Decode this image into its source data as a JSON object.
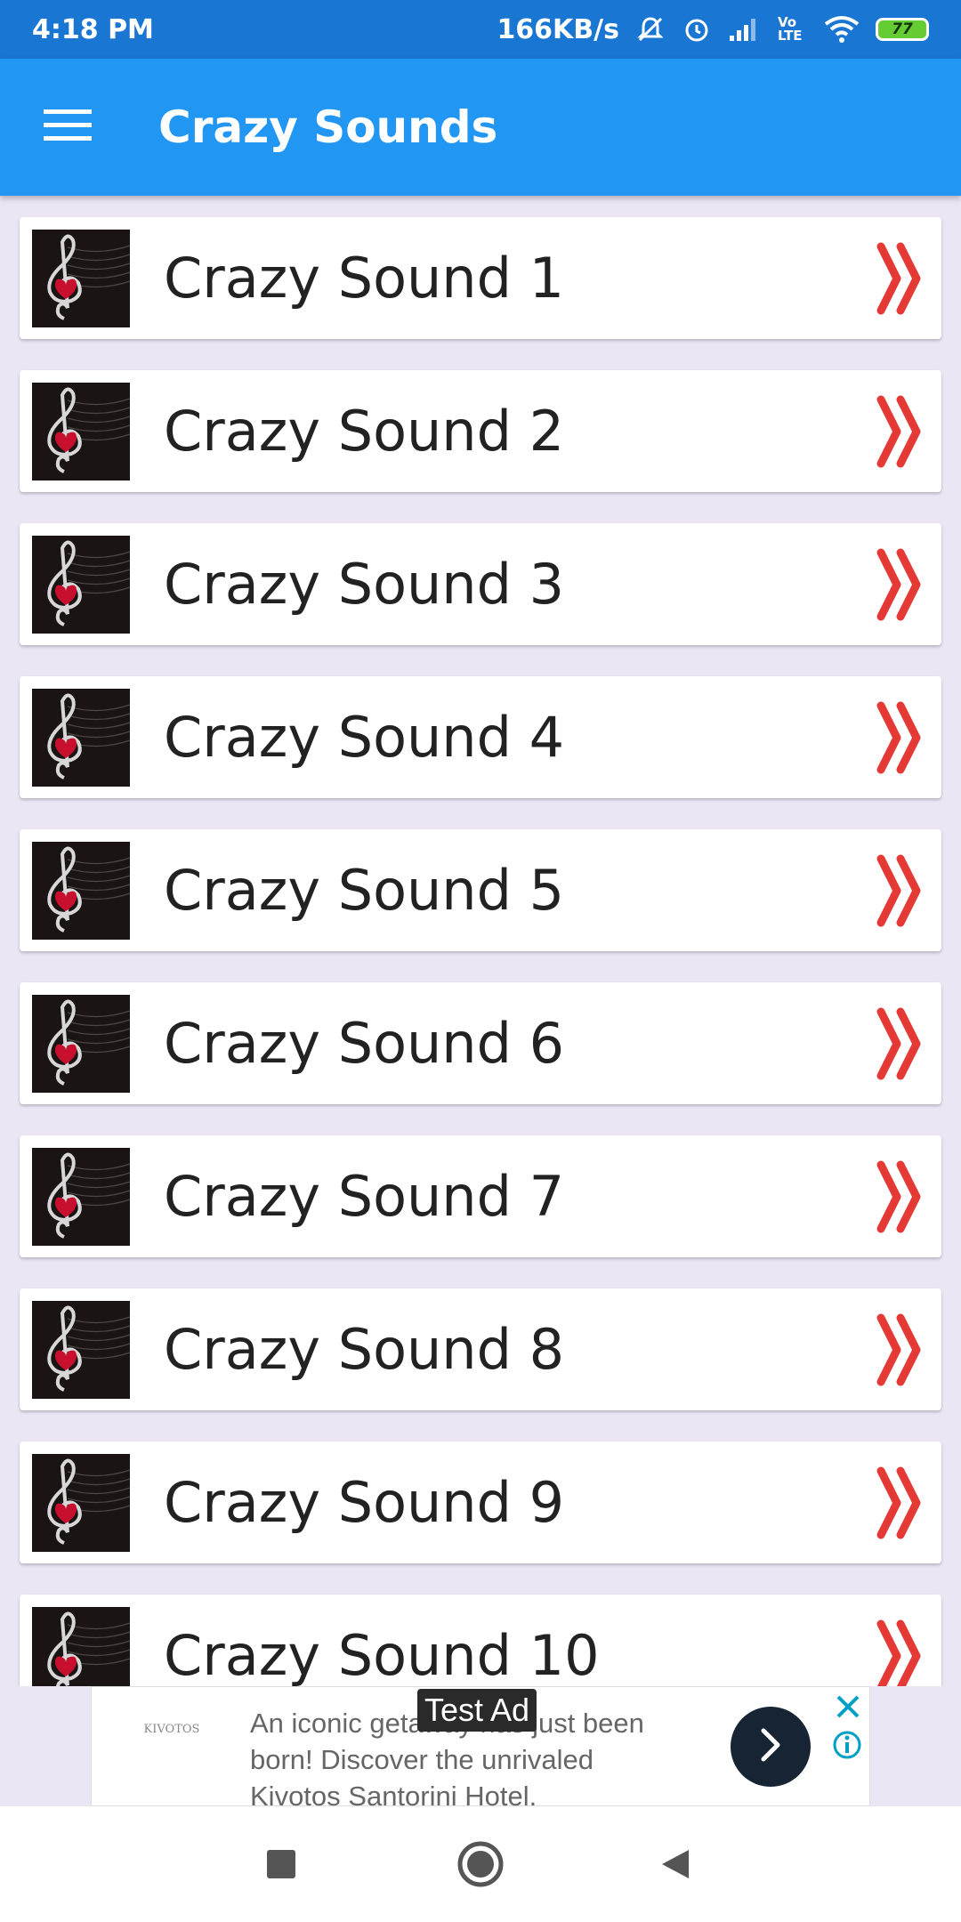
{
  "status_bar": {
    "time": "4:18 PM",
    "speed": "166KB/s",
    "volte": "Vo LTE",
    "battery": "77",
    "icons": [
      "mute-bell-icon",
      "alarm-icon",
      "signal-icon",
      "volte-icon",
      "wifi-icon",
      "battery-icon"
    ]
  },
  "app_bar": {
    "title": "Crazy Sounds",
    "menu_icon": "hamburger-menu-icon"
  },
  "list": {
    "items": [
      {
        "label": "Crazy Sound 1"
      },
      {
        "label": "Crazy Sound 2"
      },
      {
        "label": "Crazy Sound 3"
      },
      {
        "label": "Crazy Sound 4"
      },
      {
        "label": "Crazy Sound 5"
      },
      {
        "label": "Crazy Sound 6"
      },
      {
        "label": "Crazy Sound 7"
      },
      {
        "label": "Crazy Sound 8"
      },
      {
        "label": "Crazy Sound 9"
      },
      {
        "label": "Crazy Sound 10"
      }
    ],
    "thumbnail_icon": "treble-clef-heart-icon",
    "arrow_icon": "double-chevron-right-icon",
    "arrow_color": "#e53935"
  },
  "ad": {
    "badge": "Test Ad",
    "logo_text": "KIVOTOS",
    "text": "An iconic getaway has just been born! Discover the unrivaled Kivotos Santorini Hotel.",
    "go_icon": "chevron-right-icon",
    "close_icon": "close-icon",
    "info_icon": "info-icon"
  },
  "nav_bar": {
    "icons": [
      "recents-square-icon",
      "home-circle-icon",
      "back-triangle-icon"
    ]
  },
  "colors": {
    "status_bar": "#1976d2",
    "app_bar": "#2196f3",
    "background": "#ebe6f4",
    "accent_arrow": "#e53935"
  }
}
